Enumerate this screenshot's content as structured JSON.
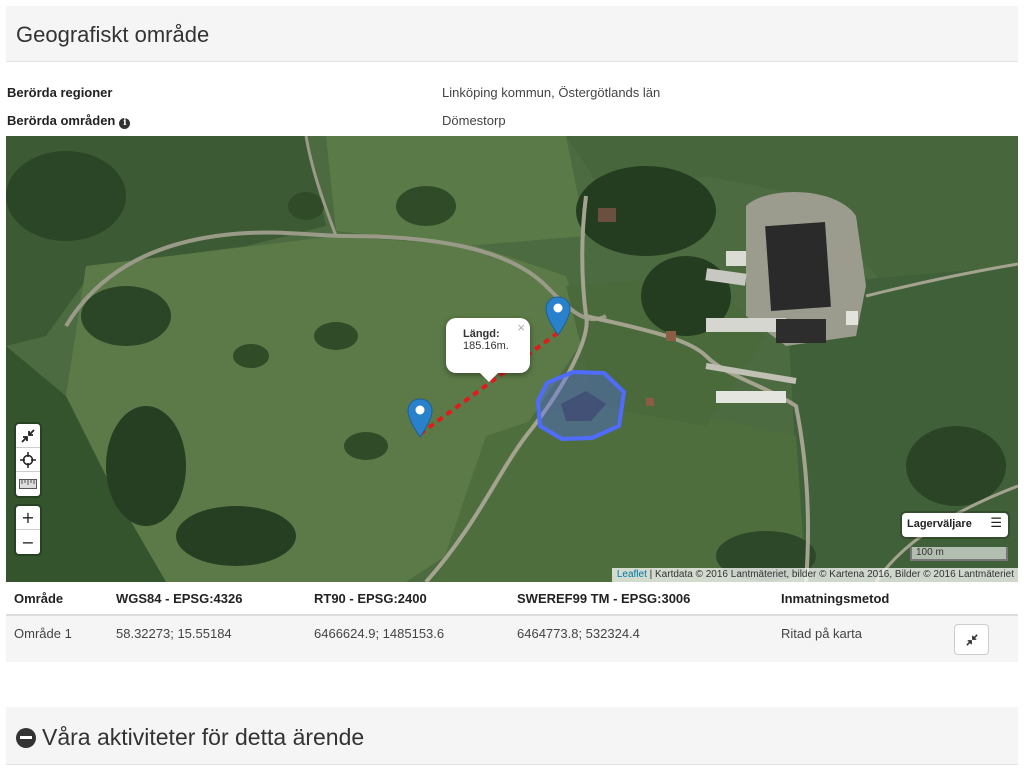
{
  "section_geo": {
    "title": "Geografiskt område",
    "regions_label": "Berörda regioner",
    "regions_value": "Linköping kommun, Östergötlands län",
    "areas_label": "Berörda områden",
    "areas_value": "Dömestorp",
    "info_icon": "info-icon"
  },
  "map": {
    "popup_title": "Längd:",
    "popup_value": "185.16m.",
    "popup_close": "×",
    "layer_button_label": "Lagerväljare",
    "scale_label": "100 m",
    "attribution_link": "Leaflet",
    "attribution_text": " | Kartdata © 2016 Lantmäteriet, bilder © Kartena 2016, Bilder © 2016 Lantmäteriet",
    "zoom_in": "+",
    "zoom_out": "−",
    "icons": [
      "collapse-icon",
      "crosshair-icon",
      "ruler-icon",
      "map-marker-icon",
      "menu-icon"
    ],
    "marker_color": "#2a81cb",
    "polygon_color": "#4f6cff",
    "line_color": "#e31a1c"
  },
  "coord_table": {
    "headers": [
      "Område",
      "WGS84 - EPSG:4326",
      "RT90 - EPSG:2400",
      "SWEREF99 TM - EPSG:3006",
      "Inmatningsmetod"
    ],
    "rows": [
      {
        "area": "Område 1",
        "wgs84": "58.32273; 15.55184",
        "rt90": "6466624.9; 1485153.6",
        "sweref": "6464773.8; 532324.4",
        "method": "Ritad på karta"
      }
    ]
  },
  "section_activities": {
    "title": "Våra aktiviteter för detta ärende",
    "icon": "minus-circle-icon"
  }
}
